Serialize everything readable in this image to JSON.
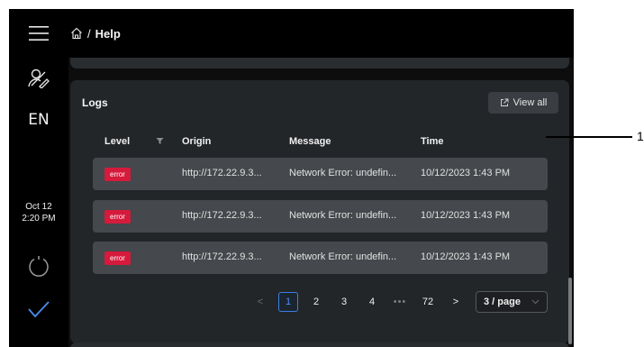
{
  "sidebar": {
    "language": "EN",
    "date": "Oct 12",
    "time": "2:20 PM",
    "icons": [
      "hamburger-menu-icon",
      "user-edit-icon",
      "power-icon",
      "checkmark-icon"
    ]
  },
  "header": {
    "breadcrumb_separator": "/",
    "breadcrumb_current": "Help"
  },
  "logs": {
    "title": "Logs",
    "view_all_label": "View all",
    "columns": {
      "level": "Level",
      "origin": "Origin",
      "message": "Message",
      "time": "Time"
    },
    "rows": [
      {
        "level": "error",
        "origin": "http://172.22.9.3...",
        "message": "Network Error: undefin...",
        "time": "10/12/2023 1:43 PM"
      },
      {
        "level": "error",
        "origin": "http://172.22.9.3...",
        "message": "Network Error: undefin...",
        "time": "10/12/2023 1:43 PM"
      },
      {
        "level": "error",
        "origin": "http://172.22.9.3...",
        "message": "Network Error: undefin...",
        "time": "10/12/2023 1:43 PM"
      }
    ],
    "pagination": {
      "prev": "<",
      "pages": [
        "1",
        "2",
        "3",
        "4"
      ],
      "ellipsis": "•••",
      "last": "72",
      "next": ">",
      "current_page": "1",
      "page_size": "3 / page"
    }
  },
  "annotation": {
    "label": "1"
  },
  "colors": {
    "error_badge": "#d61a3c",
    "active_page": "#4a8ff0",
    "accent_blue": "#4a8ff0"
  }
}
